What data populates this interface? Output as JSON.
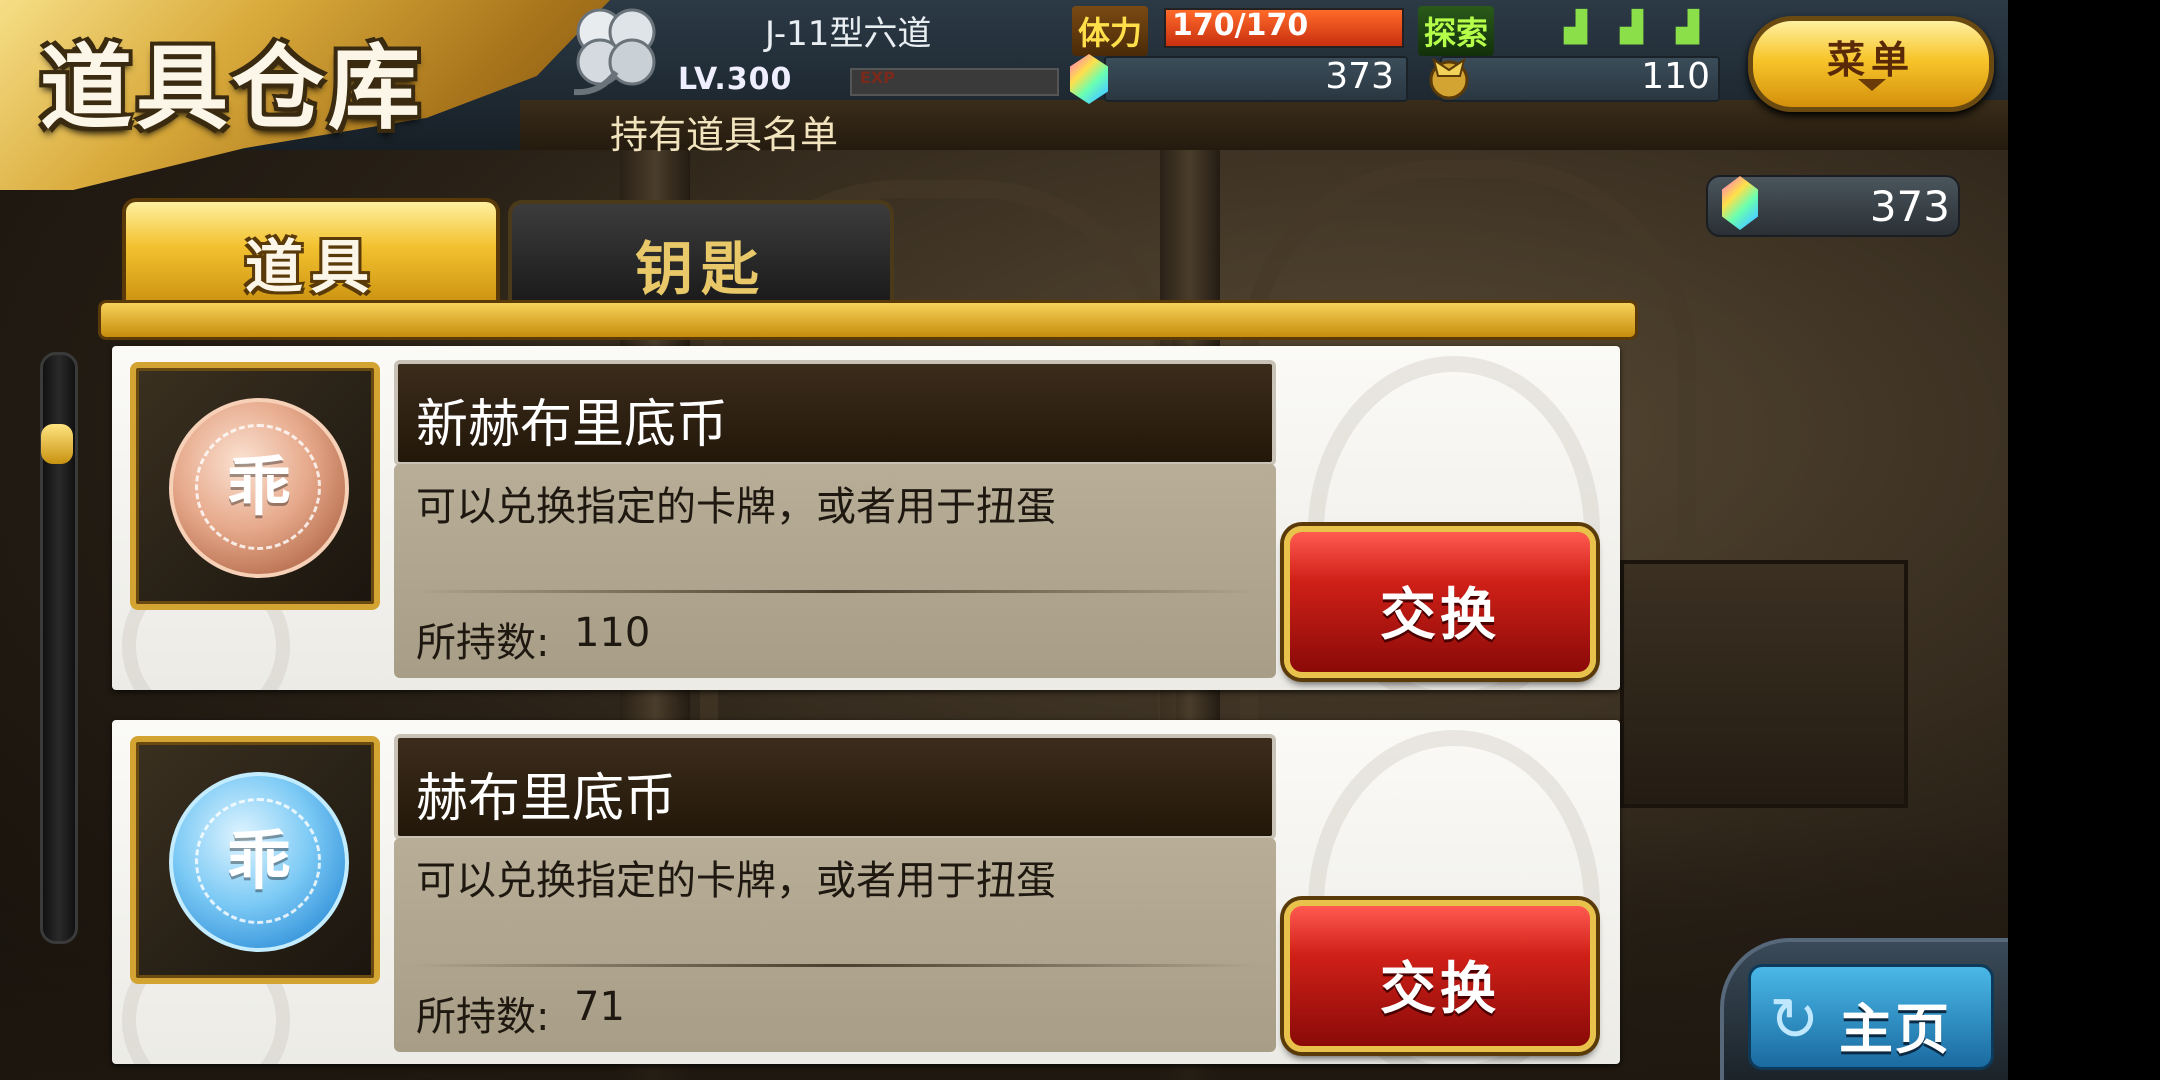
{
  "header": {
    "title": "道具仓库",
    "player_name": "J-11型六道",
    "level_label": "LV.300",
    "exp_label": "EXP",
    "stamina_label": "体力",
    "stamina_value": "170/170",
    "stamina_fraction": 1.0,
    "explore_label": "探索",
    "explore_charges": 3,
    "gem_count": "373",
    "medal_count": "110",
    "menu_label": "菜单",
    "subtitle": "持有道具名单"
  },
  "side_gem_count": "373",
  "tabs": [
    {
      "label": "道具",
      "active": true
    },
    {
      "label": "钥匙",
      "active": false
    }
  ],
  "items": [
    {
      "name": "新赫布里底币",
      "description": "可以兑换指定的卡牌，或者用于扭蛋",
      "count_label": "所持数:",
      "count": "110",
      "coin_color": "bronze",
      "coin_glyph": "乖",
      "button_label": "交换"
    },
    {
      "name": "赫布里底币",
      "description": "可以兑换指定的卡牌，或者用于扭蛋",
      "count_label": "所持数:",
      "count": "71",
      "coin_color": "blue",
      "coin_glyph": "乖",
      "button_label": "交换"
    }
  ],
  "home_button_label": "主页",
  "colors": {
    "gold": "#f3c230",
    "exchange_red": "#d02018",
    "stamina_orange": "#ff6a2a",
    "explore_green": "#8be04a"
  }
}
